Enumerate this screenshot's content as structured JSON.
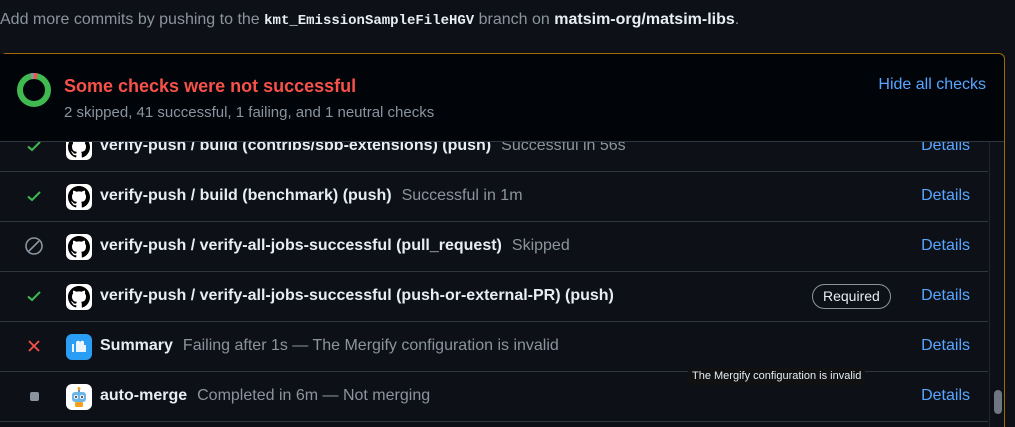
{
  "intro": {
    "prefix": "Add more commits by pushing to the",
    "branch": "kmt_EmissionSampleFileHGV",
    "middle": "branch on",
    "repo": "matsim-org/matsim-libs",
    "suffix": "."
  },
  "header": {
    "title": "Some checks were not successful",
    "subtitle": "2 skipped, 41 successful, 1 failing, and 1 neutral checks",
    "toggle_label": "Hide all checks"
  },
  "checks": [
    {
      "status": "success",
      "icon": "github-icon",
      "name": "verify-push / build (contribs/sbb-extensions) (push)",
      "desc": "Successful in 56s",
      "badge": "",
      "details": "Details"
    },
    {
      "status": "success",
      "icon": "github-icon",
      "name": "verify-push / build (benchmark) (push)",
      "desc": "Successful in 1m",
      "badge": "",
      "details": "Details"
    },
    {
      "status": "skipped",
      "icon": "github-icon",
      "name": "verify-push / verify-all-jobs-successful (pull_request)",
      "desc": "Skipped",
      "badge": "",
      "details": "Details"
    },
    {
      "status": "success",
      "icon": "github-icon",
      "name": "verify-push / verify-all-jobs-successful (push-or-external-PR) (push)",
      "desc": "",
      "badge": "Required",
      "details": "Details"
    },
    {
      "status": "failure",
      "icon": "mergify-icon",
      "name": "Summary",
      "desc": "Failing after 1s — The Mergify configuration is invalid",
      "badge": "",
      "details": "Details"
    },
    {
      "status": "neutral",
      "icon": "robot-icon",
      "name": "auto-merge",
      "desc": "Completed in 6m — Not merging",
      "badge": "",
      "details": "Details"
    }
  ],
  "tooltip": "The Mergify configuration is invalid",
  "colors": {
    "success": "#3fb950",
    "failure": "#f85149",
    "link": "#58a6ff",
    "muted": "#8b949e",
    "border_warning": "#9e6a03"
  }
}
